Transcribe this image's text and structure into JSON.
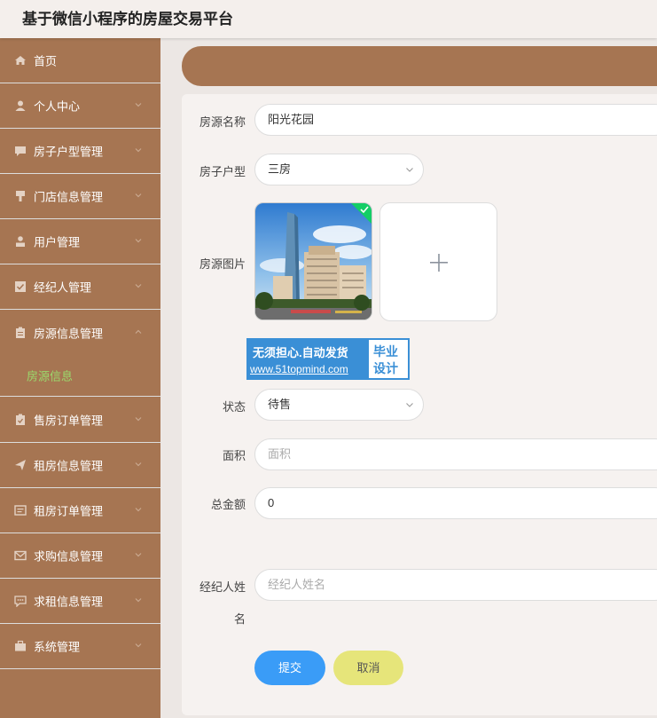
{
  "app": {
    "title": "基于微信小程序的房屋交易平台"
  },
  "colors": {
    "sidebar_bg": "#a67552",
    "accent_green": "#9bd96c",
    "submit_blue": "#3a9cf7",
    "cancel_yellow": "#e6e57a"
  },
  "sidebar": {
    "items": [
      {
        "label": "首页",
        "icon": "home-icon"
      },
      {
        "label": "个人中心",
        "icon": "user-icon"
      },
      {
        "label": "房子户型管理",
        "icon": "chat-icon"
      },
      {
        "label": "门店信息管理",
        "icon": "pin-icon"
      },
      {
        "label": "用户管理",
        "icon": "person-icon"
      },
      {
        "label": "经纪人管理",
        "icon": "check-square-icon"
      },
      {
        "label": "房源信息管理",
        "icon": "clipboard-icon"
      },
      {
        "label": "售房订单管理",
        "icon": "clipboard-check-icon"
      },
      {
        "label": "租房信息管理",
        "icon": "send-icon"
      },
      {
        "label": "租房订单管理",
        "icon": "message-icon"
      },
      {
        "label": "求购信息管理",
        "icon": "mail-icon"
      },
      {
        "label": "求租信息管理",
        "icon": "comment-icon"
      },
      {
        "label": "系统管理",
        "icon": "briefcase-icon"
      }
    ],
    "subitem": {
      "label": "房源信息"
    }
  },
  "form": {
    "name": {
      "label": "房源名称",
      "value": "阳光花园"
    },
    "layout": {
      "label": "房子户型",
      "value": "三房"
    },
    "image": {
      "label": "房源图片"
    },
    "status": {
      "label": "状态",
      "value": "待售"
    },
    "area": {
      "label": "面积",
      "placeholder": "面积"
    },
    "total": {
      "label": "总金额",
      "value": "0"
    },
    "agent": {
      "label_line1": "经纪人姓",
      "label_line2": "名",
      "placeholder": "经纪人姓名"
    },
    "submit_label": "提交",
    "cancel_label": "取消"
  },
  "watermark": {
    "line1": "无须担心.自动发货",
    "line2": "www.51topmind.com",
    "side1": "毕业",
    "side2": "设计"
  }
}
